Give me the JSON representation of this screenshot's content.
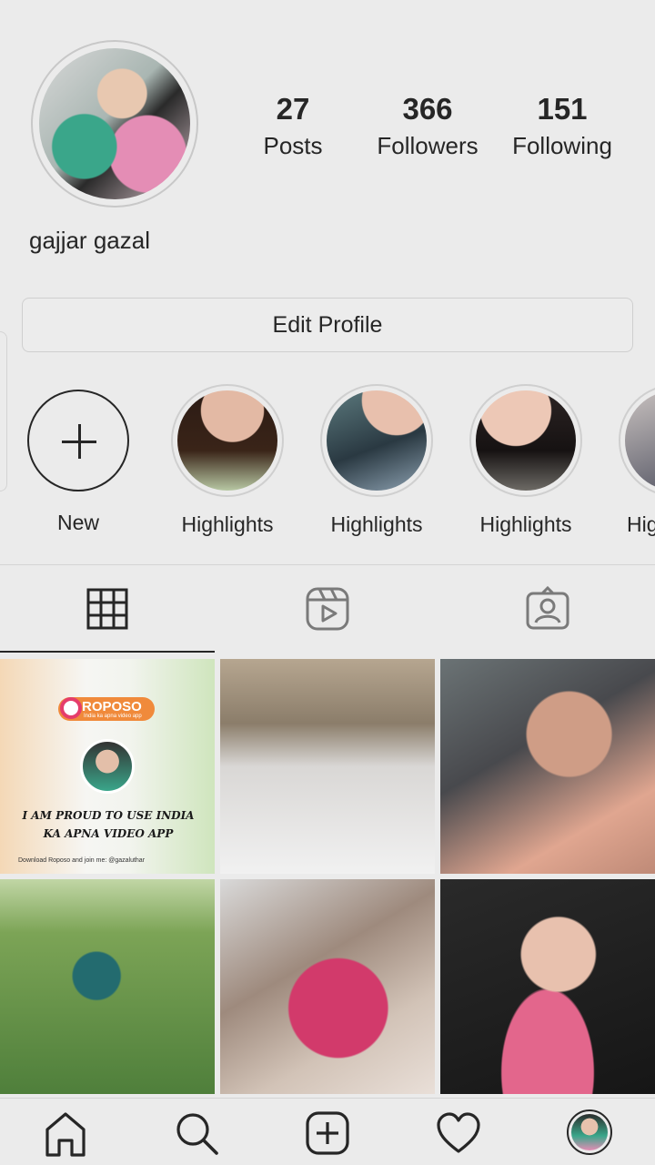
{
  "profile": {
    "username": "gajjar gazal",
    "stats": {
      "posts": {
        "value": "27",
        "label": "Posts"
      },
      "followers": {
        "value": "366",
        "label": "Followers"
      },
      "following": {
        "value": "151",
        "label": "Following"
      }
    },
    "edit_button": "Edit Profile"
  },
  "highlights": [
    {
      "label": "New",
      "icon": "plus-icon"
    },
    {
      "label": "Highlights"
    },
    {
      "label": "Highlights"
    },
    {
      "label": "Highlights"
    },
    {
      "label": "Hig"
    }
  ],
  "tabs": [
    {
      "name": "posts-grid",
      "icon": "grid-icon",
      "active": true
    },
    {
      "name": "reels",
      "icon": "reels-icon",
      "active": false
    },
    {
      "name": "tagged",
      "icon": "tagged-person-icon",
      "active": false
    }
  ],
  "posts": {
    "first_post": {
      "brand": "ROPOSO",
      "tagline": "India ka apna video app",
      "slogan": "I AM PROUD TO USE INDIA KA APNA VIDEO APP",
      "footer": "Download Roposo and join me: @gazaluthar"
    }
  },
  "bottom_nav": [
    {
      "name": "home",
      "icon": "home-icon"
    },
    {
      "name": "search",
      "icon": "search-icon"
    },
    {
      "name": "create",
      "icon": "add-post-icon"
    },
    {
      "name": "activity",
      "icon": "heart-icon"
    },
    {
      "name": "profile",
      "icon": "profile-avatar-icon"
    }
  ],
  "colors": {
    "background": "#ebebeb",
    "text": "#262626",
    "border": "#d4d4d4"
  }
}
